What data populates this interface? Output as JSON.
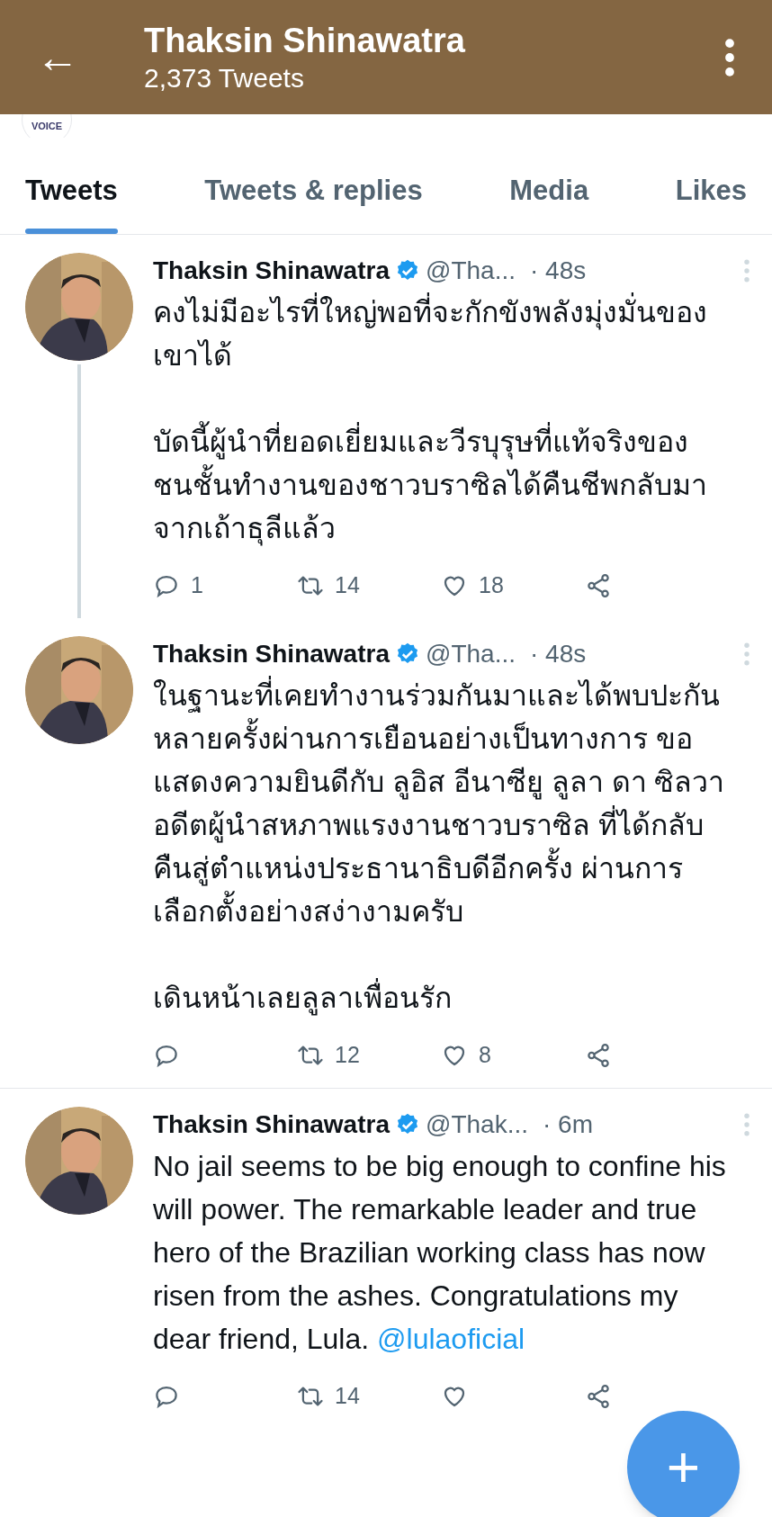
{
  "header": {
    "back": "←",
    "title": "Thaksin Shinawatra",
    "subtitle": "2,373 Tweets"
  },
  "followed_avatar": "VOICE",
  "tabs": [
    {
      "label": "Tweets",
      "selected": true
    },
    {
      "label": "Tweets & replies",
      "selected": false
    },
    {
      "label": "Media",
      "selected": false
    },
    {
      "label": "Likes",
      "selected": false
    }
  ],
  "tweets": [
    {
      "name": "Thaksin Shinawatra",
      "verified": true,
      "handle": "@Tha...",
      "time": "· 48s",
      "thread": true,
      "text": "คงไม่มีอะไรที่ใหญ่พอที่จะกักขังพลังมุ่งมั่นของเขาได้\n\nบัดนี้ผู้นำที่ยอดเยี่ยมและวีรบุรุษที่แท้จริงของชนชั้นทำงานของชาวบราซิลได้คืนชีพกลับมาจากเถ้าธุลีแล้ว",
      "replies": "1",
      "retweets": "14",
      "likes": "18"
    },
    {
      "name": "Thaksin Shinawatra",
      "verified": true,
      "handle": "@Tha...",
      "time": "· 48s",
      "thread": false,
      "text": "ในฐานะที่เคยทำงานร่วมกันมาและได้พบปะกันหลายครั้งผ่านการเยือนอย่างเป็นทางการ ขอแสดงความยินดีกับ ลูอิส อีนาซียู ลูลา ดา ซิลวา อดีตผู้นำสหภาพแรงงานชาวบราซิล ที่ได้กลับคืนสู่ตำแหน่งประธานาธิบดีอีกครั้ง ผ่านการเลือกตั้งอย่างสง่างามครับ\n\nเดินหน้าเลยลูลาเพื่อนรัก",
      "retweets": "12",
      "likes": "8"
    },
    {
      "name": "Thaksin Shinawatra",
      "verified": true,
      "handle": "@Thak...",
      "time": "· 6m",
      "thread": false,
      "text": "No jail seems to be big enough to confine his will power. The remarkable leader and true hero of the Brazilian working class has now risen from the ashes. Congratulations  my dear friend, Lula.",
      "mention": "@lulaoficial",
      "retweets": "14"
    }
  ],
  "fab": "+"
}
